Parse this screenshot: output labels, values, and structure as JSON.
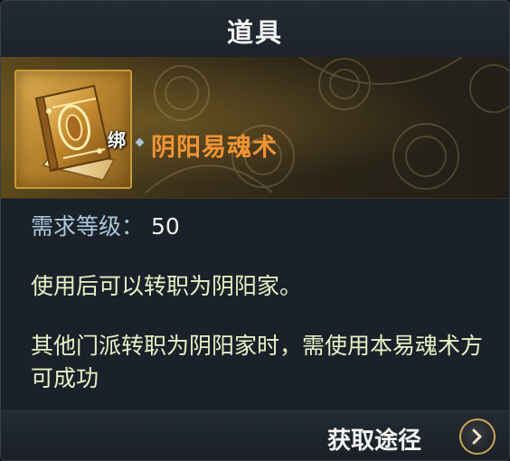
{
  "panel": {
    "title": "道具"
  },
  "item": {
    "bind_badge": "绑",
    "name": "阴阳易魂术",
    "icon": "golden-book-icon",
    "name_color": "#f39433"
  },
  "requirement": {
    "label": "需求等级：",
    "value": "50"
  },
  "description": {
    "line1": "使用后可以转职为阴阳家。",
    "line2": "其他门派转职为阴阳家时，需使用本易魂术方可成功"
  },
  "footer": {
    "obtain_label": "获取途径",
    "obtain_icon": "chevron-right-icon"
  },
  "colors": {
    "accent_gold": "#c9a65a",
    "requirement_label": "#a9c8dc",
    "description_text": "#eaf0c8"
  }
}
